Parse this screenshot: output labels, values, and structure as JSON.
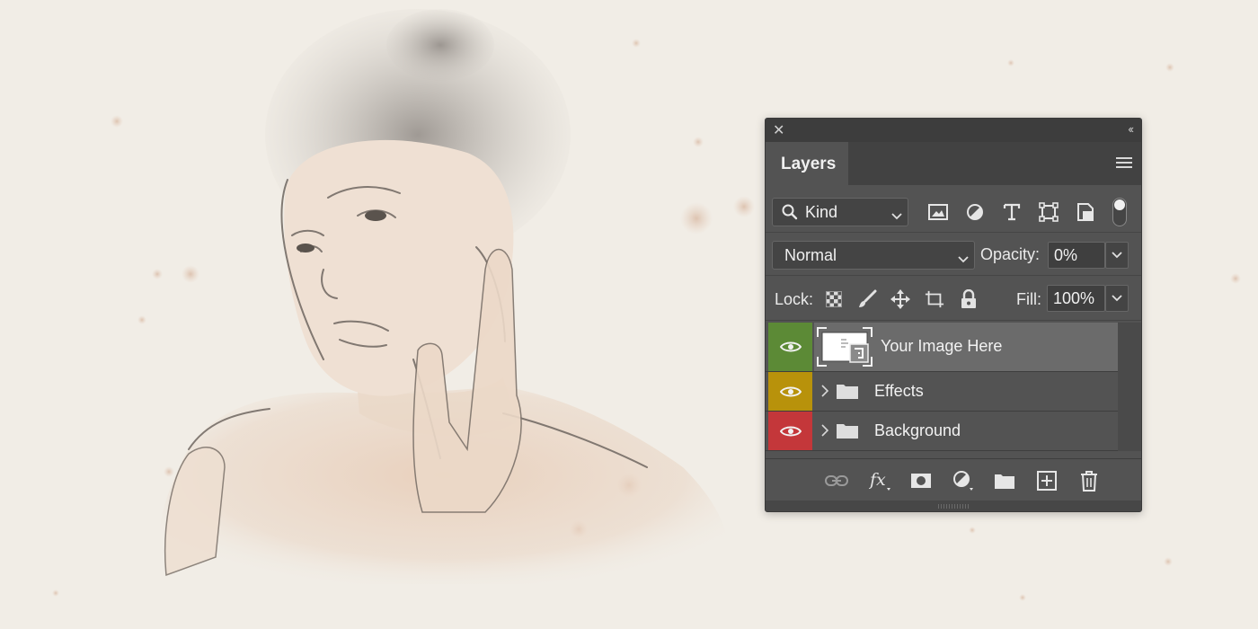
{
  "panel": {
    "title": "Layers",
    "filter": {
      "label": "Kind"
    },
    "blend_mode": "Normal",
    "opacity": {
      "label": "Opacity:",
      "value": "0%"
    },
    "lock": {
      "label": "Lock:"
    },
    "fill": {
      "label": "Fill:",
      "value": "100%"
    },
    "layers": [
      {
        "name": "Your Image Here",
        "type": "smart-object",
        "color_tag": "#5c8a36",
        "visible": true,
        "selected": true
      },
      {
        "name": "Effects",
        "type": "group",
        "color_tag": "#b8920b",
        "visible": true,
        "selected": false
      },
      {
        "name": "Background",
        "type": "group",
        "color_tag": "#c4373a",
        "visible": true,
        "selected": false
      }
    ],
    "filter_icons": [
      "image-filter-icon",
      "adjustment-filter-icon",
      "type-filter-icon",
      "shape-filter-icon",
      "smart-object-filter-icon"
    ],
    "lock_icons": [
      "lock-transparent-icon",
      "lock-image-icon",
      "lock-position-icon",
      "lock-artboard-icon",
      "lock-all-icon"
    ],
    "bottom_icons": [
      "link-layers-icon",
      "fx-icon",
      "add-mask-icon",
      "adjustment-layer-icon",
      "new-group-icon",
      "new-layer-icon",
      "delete-icon"
    ],
    "colors": {
      "panel_bg": "#535353",
      "selected_row": "#6b6b6b"
    }
  },
  "canvas": {
    "background": "#f1ede6"
  }
}
